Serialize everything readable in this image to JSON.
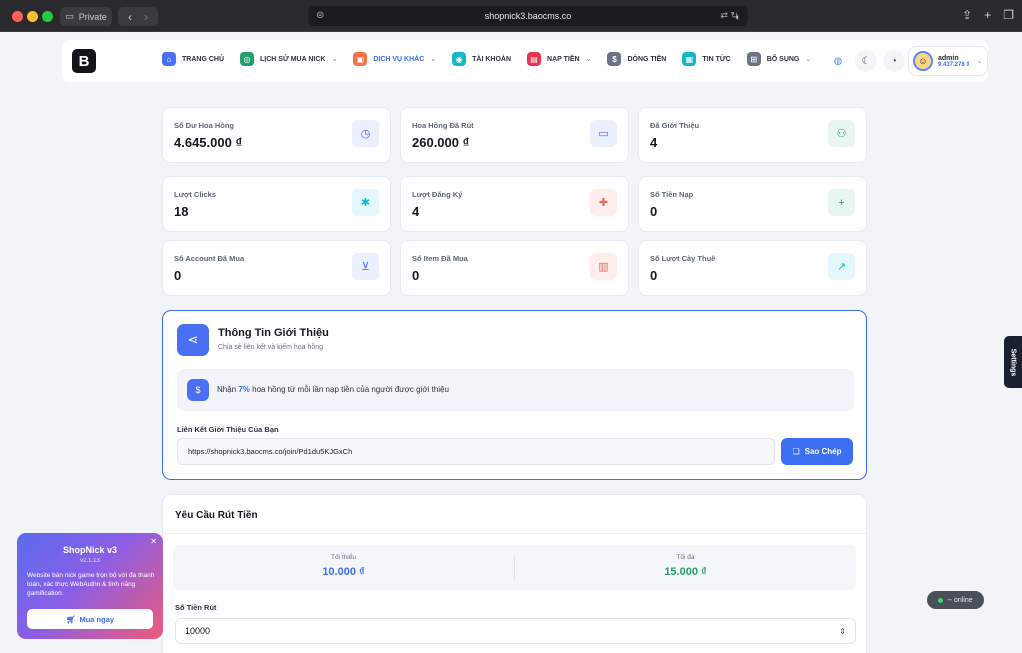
{
  "browser": {
    "private_label": "Private",
    "url": "shopnick3.baocms.co"
  },
  "nav": {
    "logo": "B",
    "items": [
      {
        "label": "TRANG CHỦ",
        "color": "#4a6ff2",
        "icon": "home-icon",
        "caret": false
      },
      {
        "label": "LỊCH SỬ MUA NICK",
        "color": "#22a06b",
        "icon": "gamepad-icon",
        "caret": true
      },
      {
        "label": "DỊCH VỤ KHÁC",
        "color": "#f0734a",
        "icon": "box-icon",
        "caret": true,
        "active": true
      },
      {
        "label": "TÀI KHOẢN",
        "color": "#14b8c8",
        "icon": "user-icon",
        "caret": false
      },
      {
        "label": "NẠP TIỀN",
        "color": "#e8364f",
        "icon": "wallet-icon",
        "caret": true
      },
      {
        "label": "DÒNG TIỀN",
        "color": "#6b7385",
        "icon": "dollar-icon",
        "caret": false
      },
      {
        "label": "TIN TỨC",
        "color": "#14b8c8",
        "icon": "news-icon",
        "caret": false
      },
      {
        "label": "BỔ SUNG",
        "color": "#6b7385",
        "icon": "plus-square-icon",
        "caret": true
      }
    ],
    "user": {
      "name": "admin",
      "balance": "9.437.278 ₫"
    }
  },
  "stats": [
    {
      "label": "Số Dư Hoa Hồng",
      "value": "4.645.000 ₫",
      "icon": "clock-icon",
      "bg": "#eceffd",
      "fg": "#4a6ff2"
    },
    {
      "label": "Hoa Hồng Đã Rút",
      "value": "260.000 ₫",
      "icon": "card-icon",
      "bg": "#eceffd",
      "fg": "#4a6ff2"
    },
    {
      "label": "Đã Giới Thiệu",
      "value": "4",
      "icon": "users-icon",
      "bg": "#e7f6ee",
      "fg": "#22a06b"
    },
    {
      "label": "Lượt Clicks",
      "value": "18",
      "icon": "pointer-icon",
      "bg": "#e4f7fa",
      "fg": "#14b8c8"
    },
    {
      "label": "Lượt Đăng Ký",
      "value": "4",
      "icon": "user-plus-icon",
      "bg": "#fdeeed",
      "fg": "#e86a5a"
    },
    {
      "label": "Số Tiền Nạp",
      "value": "0",
      "icon": "plus-icon",
      "bg": "#e7f6ee",
      "fg": "#22a06b"
    },
    {
      "label": "Số Account Đã Mua",
      "value": "0",
      "icon": "cart-icon",
      "bg": "#eceffd",
      "fg": "#4a6ff2"
    },
    {
      "label": "Số Item Đã Mua",
      "value": "0",
      "icon": "archive-icon",
      "bg": "#fdeeed",
      "fg": "#e86a5a"
    },
    {
      "label": "Số Lượt Cày Thuê",
      "value": "0",
      "icon": "trend-up-icon",
      "bg": "#e4f7fa",
      "fg": "#14b8c8"
    }
  ],
  "referral": {
    "title": "Thông Tin Giới Thiệu",
    "subtitle": "Chia sẻ liên kết và kiếm hoa hồng",
    "note_prefix": "Nhận ",
    "note_percent": "7%",
    "note_suffix": " hoa hồng từ mỗi lần nạp tiền của người được giới thiệu",
    "link_label": "Liên Kết Giới Thiệu Của Bạn",
    "link_value": "https://shopnick3.baocms.co/join/Pd1du5KJGxCh",
    "copy_label": "Sao Chép"
  },
  "withdraw": {
    "title": "Yêu Cầu Rút Tiền",
    "min_label": "Tối thiểu",
    "min_value": "10.000 ₫",
    "max_label": "Tối đa",
    "max_value": "15.000 ₫",
    "amount_label": "Số Tiền Rút",
    "amount_value": "10000"
  },
  "promo": {
    "title": "ShopNick v3",
    "version": "v2.1.13",
    "description": "Website bán nick game trọn bộ với đa thanh toán, xác thực WebAuthn & tính năng gamification.",
    "button": "Mua ngay"
  },
  "settings_tab": "Settings",
  "online": "-- online"
}
